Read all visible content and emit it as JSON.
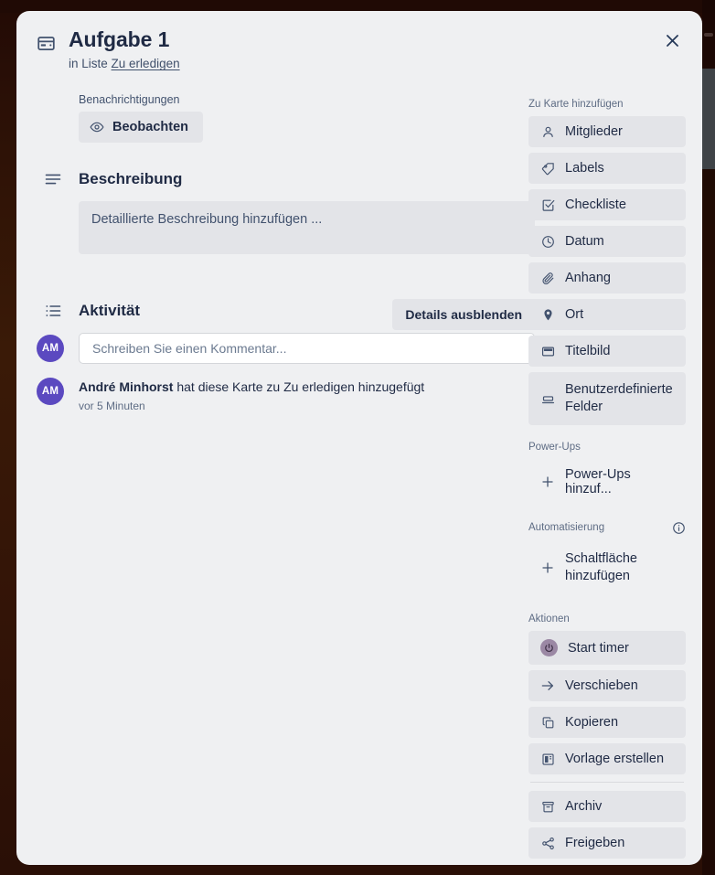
{
  "window": {
    "background_color": "#2a0f08",
    "card_background": "#eff0f2"
  },
  "header": {
    "card_icon": "card-icon",
    "title": "Aufgabe 1",
    "subtitle_prefix": "in Liste",
    "subtitle_link": "Zu erledigen",
    "close_icon": "close-icon"
  },
  "notifications": {
    "label": "Benachrichtigungen",
    "watch_button": {
      "label": "Beobachten",
      "icon": "eye-icon"
    }
  },
  "description": {
    "heading": "Beschreibung",
    "heading_icon": "lines-icon",
    "placeholder": "Detaillierte Beschreibung hinzufügen ..."
  },
  "activity": {
    "heading": "Aktivität",
    "heading_icon": "activity-list-icon",
    "toggle_details_label": "Details ausblenden",
    "comment_placeholder": "Schreiben Sie einen Kommentar...",
    "avatar_initials": "AM",
    "avatar_color": "#5b49c0",
    "entries": [
      {
        "author": "André Minhorst",
        "text": "hat diese Karte zu Zu erledigen hinzugefügt",
        "time": "vor 5 Minuten",
        "avatar_initials": "AM"
      }
    ]
  },
  "sidebar": {
    "add_to_card": {
      "label": "Zu Karte hinzufügen",
      "items": [
        {
          "label": "Mitglieder",
          "icon": "person-icon"
        },
        {
          "label": "Labels",
          "icon": "tag-icon"
        },
        {
          "label": "Checkliste",
          "icon": "checkbox-icon"
        },
        {
          "label": "Datum",
          "icon": "clock-icon"
        },
        {
          "label": "Anhang",
          "icon": "paperclip-icon"
        },
        {
          "label": "Ort",
          "icon": "location-pin-icon"
        },
        {
          "label": "Titelbild",
          "icon": "cover-image-icon"
        },
        {
          "label": "Benutzerdefinierte Felder",
          "icon": "custom-fields-icon"
        }
      ]
    },
    "power_ups": {
      "label": "Power-Ups",
      "items": [
        {
          "label": "Power-Ups hinzuf...",
          "icon": "plus-icon"
        }
      ]
    },
    "automation": {
      "label": "Automatisierung",
      "info_icon": "info-icon",
      "items": [
        {
          "label": "Schaltfläche hinzufügen",
          "icon": "plus-icon"
        }
      ]
    },
    "actions": {
      "label": "Aktionen",
      "items": [
        {
          "label": "Start timer",
          "icon": "power-timer-icon",
          "badge_color": "#9b88a4"
        },
        {
          "label": "Verschieben",
          "icon": "arrow-right-icon"
        },
        {
          "label": "Kopieren",
          "icon": "copy-icon"
        },
        {
          "label": "Vorlage erstellen",
          "icon": "template-icon"
        }
      ],
      "items_after_divider": [
        {
          "label": "Archiv",
          "icon": "archive-icon"
        },
        {
          "label": "Freigeben",
          "icon": "share-icon"
        }
      ]
    }
  }
}
